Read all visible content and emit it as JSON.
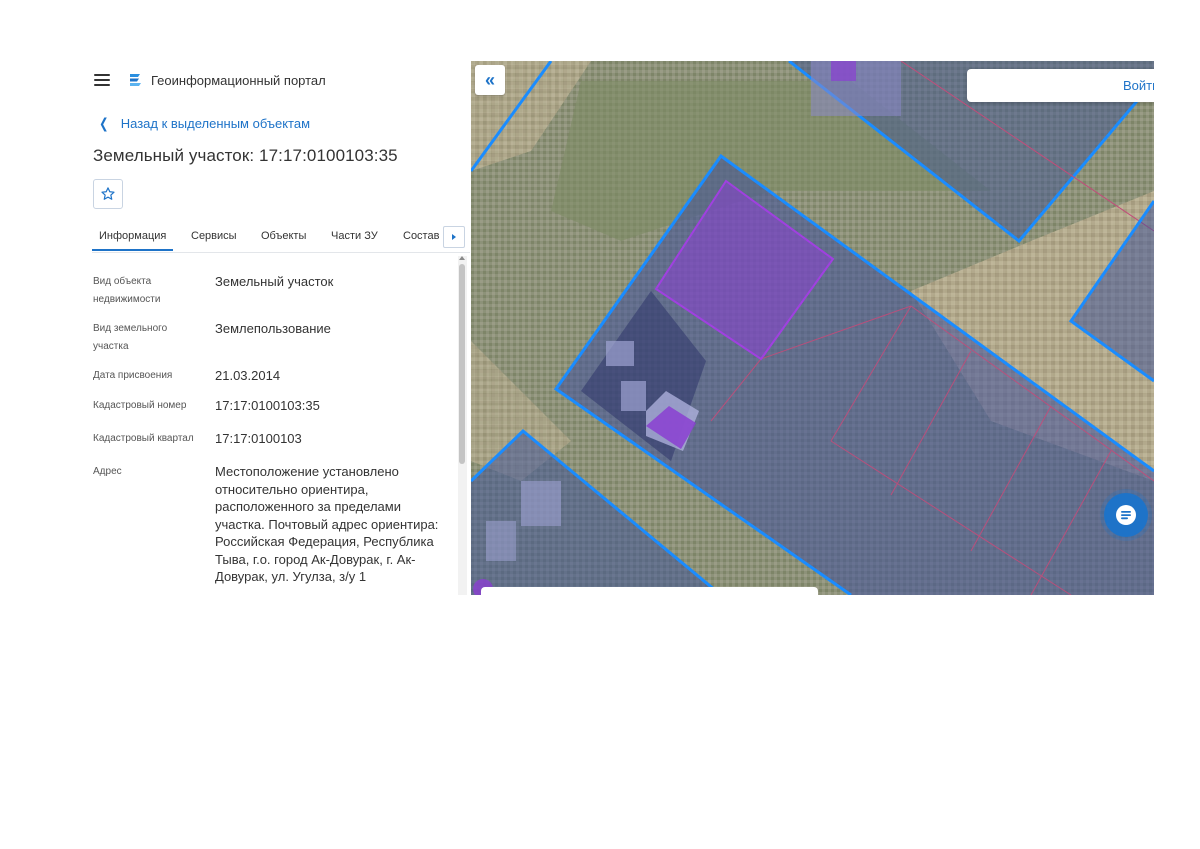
{
  "header": {
    "app_title": "Геоинформационный портал"
  },
  "nav": {
    "back_label": "Назад к выделенным объектам"
  },
  "page": {
    "title": "Земельный участок: 17:17:0100103:35"
  },
  "tabs": [
    {
      "label": "Информация",
      "active": true
    },
    {
      "label": "Сервисы",
      "active": false
    },
    {
      "label": "Объекты",
      "active": false
    },
    {
      "label": "Части ЗУ",
      "active": false
    },
    {
      "label": "Состав",
      "active": false
    }
  ],
  "info": [
    {
      "label": "Вид объекта недвижимости",
      "value": "Земельный участок"
    },
    {
      "label": "Вид земельного участка",
      "value": "Землепользование"
    },
    {
      "label": "Дата присвоения",
      "value": "21.03.2014"
    },
    {
      "label": "Кадастровый номер",
      "value": "17:17:0100103:35"
    },
    {
      "label": "Кадастровый квартал",
      "value": "17:17:0100103"
    },
    {
      "label": "Адрес",
      "value": "Местоположение установлено относительно ориентира, расположенного за пределами участка. Почтовый адрес ориентира: Российская Федерация, Республика Тыва, г.о. город Ак-Довурак, г. Ак-Довурак, ул. Угулза, з/у 1"
    }
  ],
  "map": {
    "login_label": "Войти",
    "collapse_icon": "double-chevron-left-icon",
    "chat_icon": "chat-bubble-icon"
  },
  "colors": {
    "accent": "#1e73c8",
    "parcel_outline": "#1a8cff",
    "selected_fill": "#8a3fd1"
  }
}
